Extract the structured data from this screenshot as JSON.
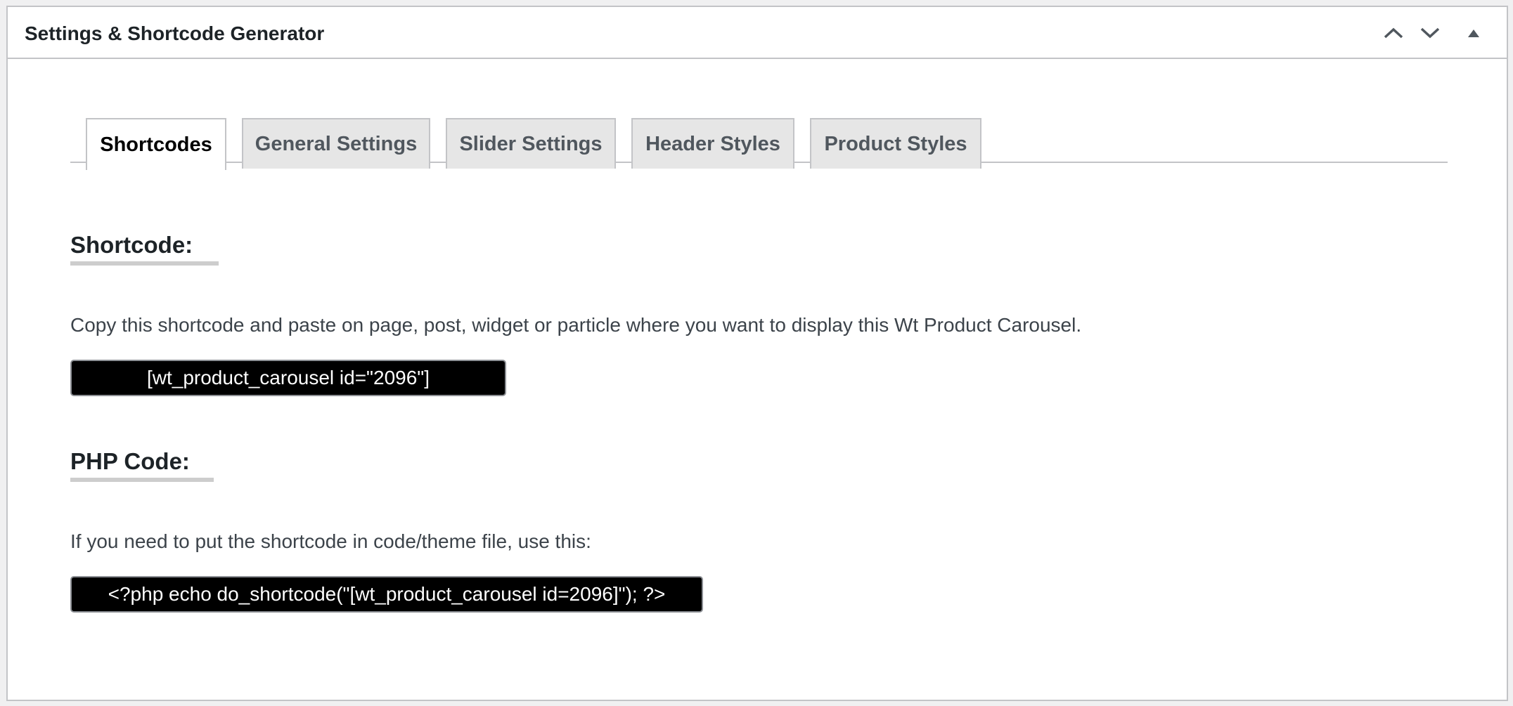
{
  "panel": {
    "title": "Settings & Shortcode Generator",
    "controls": {
      "move_up_icon": "chevron-up-icon",
      "move_down_icon": "chevron-down-icon",
      "toggle_icon": "triangle-up-icon"
    }
  },
  "tabs": [
    {
      "label": "Shortcodes",
      "active": true
    },
    {
      "label": "General Settings",
      "active": false
    },
    {
      "label": "Slider Settings",
      "active": false
    },
    {
      "label": "Header Styles",
      "active": false
    },
    {
      "label": "Product Styles",
      "active": false
    }
  ],
  "shortcode_section": {
    "heading": "Shortcode:",
    "description": "Copy this shortcode and paste on page, post, widget or particle where you want to display this Wt Product Carousel.",
    "code": "[wt_product_carousel id=\"2096\"]"
  },
  "php_section": {
    "heading": "PHP Code:",
    "description": "If you need to put the shortcode in code/theme file, use this:",
    "code": "<?php echo do_shortcode(\"[wt_product_carousel id=2096]\"); ?>"
  },
  "colors": {
    "code_background": "#000000",
    "code_text": "#ffffff",
    "tab_inactive_bg": "#e6e6e6",
    "border": "#c3c4c7"
  }
}
